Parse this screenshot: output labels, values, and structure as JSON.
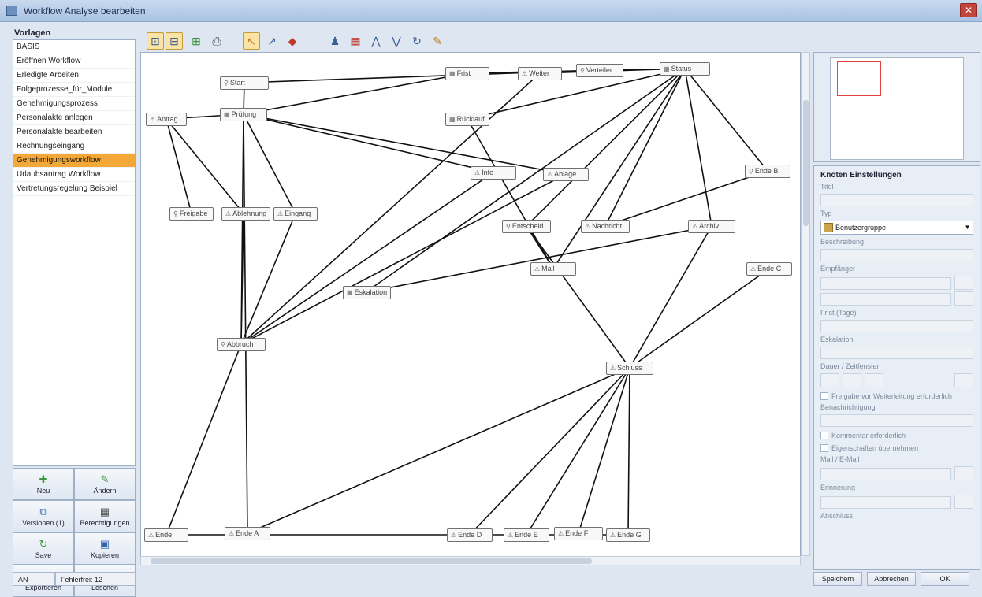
{
  "window": {
    "title": "Workflow Analyse bearbeiten",
    "close_label": "✕"
  },
  "sidebar": {
    "title": "Vorlagen",
    "items": [
      {
        "label": "BASIS",
        "selected": false
      },
      {
        "label": "Eröffnen Workflow",
        "selected": false
      },
      {
        "label": "Erledigte Arbeiten",
        "selected": false
      },
      {
        "label": "Folgeprozesse_für_Module",
        "selected": false
      },
      {
        "label": "Genehmigungsprozess",
        "selected": false
      },
      {
        "label": "Personalakte anlegen",
        "selected": false
      },
      {
        "label": "Personalakte bearbeiten",
        "selected": false
      },
      {
        "label": "Rechnungseingang",
        "selected": false
      },
      {
        "label": "Genehmigungsworkflow",
        "selected": true
      },
      {
        "label": "Urlaubsantrag Workflow",
        "selected": false
      },
      {
        "label": "Vertretungsregelung Beispiel",
        "selected": false
      }
    ],
    "buttons": [
      {
        "name": "new-button",
        "label": "Neu",
        "icon": "✚",
        "color": "g-green"
      },
      {
        "name": "edit-button",
        "label": "Ändern",
        "icon": "✎",
        "color": "g-green"
      },
      {
        "name": "versions-button",
        "label": "Versionen (1)",
        "icon": "⧉",
        "color": "g-blue"
      },
      {
        "name": "permissions-button",
        "label": "Berechtigungen",
        "icon": "▦",
        "color": "g-gray"
      },
      {
        "name": "save-button",
        "label": "Save",
        "icon": "↻",
        "color": "g-green"
      },
      {
        "name": "copy-button",
        "label": "Kopieren",
        "icon": "▣",
        "color": "g-blue"
      },
      {
        "name": "export-button",
        "label": "Exportieren",
        "icon": "✂",
        "color": "g-red"
      },
      {
        "name": "delete-button",
        "label": "Löschen",
        "icon": "✖",
        "color": "g-red"
      }
    ],
    "status_left": "AN",
    "status_right": "Fehlerfrei: 12"
  },
  "toolbar": {
    "tools": [
      {
        "name": "zoom-fit-icon",
        "glyph": "⊡",
        "color": "#3a5f96",
        "active": true
      },
      {
        "name": "zoom-page-icon",
        "glyph": "⊟",
        "color": "#3a5f96",
        "active": true
      },
      {
        "name": "layout-icon",
        "glyph": "⊞",
        "color": "#3b8f3b",
        "active": false
      },
      {
        "name": "print-icon",
        "glyph": "⎙",
        "color": "#555555",
        "active": false
      },
      {
        "name": "select-tool-icon",
        "glyph": "↖",
        "color": "#c07b1a",
        "active": true
      },
      {
        "name": "connect-tool-icon",
        "glyph": "↗",
        "color": "#3a5f96",
        "active": false
      },
      {
        "name": "eraser-tool-icon",
        "glyph": "◆",
        "color": "#c0392b",
        "active": false
      },
      {
        "name": "user-node-icon",
        "glyph": "♟",
        "color": "#3a5f96",
        "active": false
      },
      {
        "name": "group-node-icon",
        "glyph": "▦",
        "color": "#c0392b",
        "active": false
      },
      {
        "name": "split-node-icon",
        "glyph": "⋀",
        "color": "#3a5f96",
        "active": false
      },
      {
        "name": "merge-node-icon",
        "glyph": "⋁",
        "color": "#3a5f96",
        "active": false
      },
      {
        "name": "loop-node-icon",
        "glyph": "↻",
        "color": "#3a5f96",
        "active": false
      },
      {
        "name": "script-node-icon",
        "glyph": "✎",
        "color": "#c07b1a",
        "active": false
      }
    ]
  },
  "diagram": {
    "nodes": [
      {
        "id": "n1",
        "label": "Antrag",
        "icon": "⚠"
      },
      {
        "id": "n2",
        "label": "Start",
        "icon": "⚲"
      },
      {
        "id": "n3",
        "label": "Prüfung",
        "icon": "▦"
      },
      {
        "id": "n4",
        "label": "Frist",
        "icon": "▦"
      },
      {
        "id": "n5",
        "label": "Freigabe",
        "icon": "⚲"
      },
      {
        "id": "n6",
        "label": "Weiter",
        "icon": "⚠"
      },
      {
        "id": "n7",
        "label": "Verteiler",
        "icon": "⚲"
      },
      {
        "id": "n8",
        "label": "Status",
        "icon": "▦"
      },
      {
        "id": "n9",
        "label": "Ablehnung",
        "icon": "⚠"
      },
      {
        "id": "n10",
        "label": "Eingang",
        "icon": "⚠"
      },
      {
        "id": "n11",
        "label": "Info",
        "icon": "⚠"
      },
      {
        "id": "n12",
        "label": "Ablage",
        "icon": "⚠"
      },
      {
        "id": "n13",
        "label": "Abbruch",
        "icon": "⚲"
      },
      {
        "id": "n14",
        "label": "Rücklauf",
        "icon": "▦"
      },
      {
        "id": "n15",
        "label": "Eskalation",
        "icon": "▦"
      },
      {
        "id": "n16",
        "label": "Entscheid",
        "icon": "⚲"
      },
      {
        "id": "n17",
        "label": "Nachricht",
        "icon": "⚠"
      },
      {
        "id": "n18",
        "label": "Mail",
        "icon": "⚠"
      },
      {
        "id": "n19",
        "label": "Archiv",
        "icon": "⚠"
      },
      {
        "id": "n20",
        "label": "Ende",
        "icon": "⚠"
      },
      {
        "id": "n21",
        "label": "Ende A",
        "icon": "⚠"
      },
      {
        "id": "n22",
        "label": "Ende B",
        "icon": "⚲"
      },
      {
        "id": "n23",
        "label": "Ende C",
        "icon": "⚠"
      },
      {
        "id": "n24",
        "label": "Ende D",
        "icon": "⚠"
      },
      {
        "id": "n25",
        "label": "Ende E",
        "icon": "⚠"
      },
      {
        "id": "n26",
        "label": "Ende F",
        "icon": "⚠"
      },
      {
        "id": "n27",
        "label": "Ende G",
        "icon": "⚠"
      },
      {
        "id": "n28",
        "label": "Schluss",
        "icon": "⚠"
      }
    ],
    "edges": [
      [
        "n1",
        "n5"
      ],
      [
        "n1",
        "n9"
      ],
      [
        "n1",
        "n3"
      ],
      [
        "n3",
        "n2"
      ],
      [
        "n3",
        "n4"
      ],
      [
        "n2",
        "n7"
      ],
      [
        "n3",
        "n10"
      ],
      [
        "n3",
        "n11"
      ],
      [
        "n3",
        "n12"
      ],
      [
        "n3",
        "n13"
      ],
      [
        "n13",
        "n6"
      ],
      [
        "n10",
        "n13"
      ],
      [
        "n11",
        "n13"
      ],
      [
        "n12",
        "n13"
      ],
      [
        "n9",
        "n13"
      ],
      [
        "n13",
        "n20"
      ],
      [
        "n3",
        "n21"
      ],
      [
        "n6",
        "n8"
      ],
      [
        "n8",
        "n4"
      ],
      [
        "n8",
        "n14"
      ],
      [
        "n8",
        "n15"
      ],
      [
        "n8",
        "n16"
      ],
      [
        "n8",
        "n17"
      ],
      [
        "n8",
        "n18"
      ],
      [
        "n8",
        "n19"
      ],
      [
        "n8",
        "n22"
      ],
      [
        "n14",
        "n18"
      ],
      [
        "n15",
        "n19"
      ],
      [
        "n18",
        "n16"
      ],
      [
        "n17",
        "n22"
      ],
      [
        "n16",
        "n28"
      ],
      [
        "n23",
        "n28"
      ],
      [
        "n19",
        "n28"
      ],
      [
        "n28",
        "n24"
      ],
      [
        "n28",
        "n25"
      ],
      [
        "n28",
        "n26"
      ],
      [
        "n28",
        "n27"
      ],
      [
        "n28",
        "n21"
      ],
      [
        "n20",
        "n27"
      ]
    ]
  },
  "properties": {
    "title": "Knoten Einstellungen",
    "labels": {
      "name": "Titel",
      "type": "Typ",
      "description": "Beschreibung",
      "assignee": "Empfänger",
      "deadline": "Frist (Tage)",
      "escalation": "Eskalation",
      "duration": "Dauer / Zeitfenster",
      "notify": "Benachrichtigung",
      "mail": "Mail / E-Mail",
      "reminder": "Erinnerung",
      "end": "Abschluss"
    },
    "type_value": "Benutzergruppe",
    "checks": [
      "Freigabe vor Weiterleitung erforderlich",
      "Kommentar erforderlich",
      "Eigenschaften übernehmen"
    ]
  },
  "footer_buttons": [
    {
      "name": "save-footer-button",
      "label": "Speichern"
    },
    {
      "name": "cancel-footer-button",
      "label": "Abbrechen"
    },
    {
      "name": "ok-footer-button",
      "label": "OK"
    }
  ]
}
